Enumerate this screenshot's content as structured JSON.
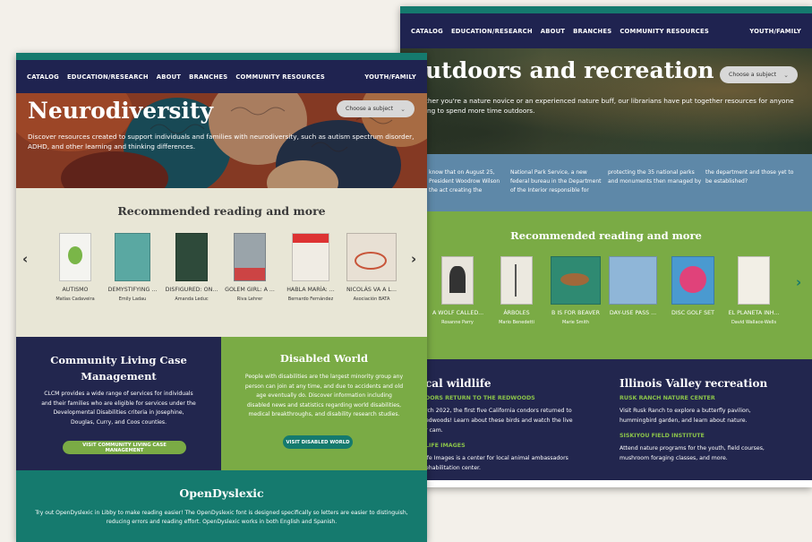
{
  "back": {
    "nav": {
      "items": [
        "CATALOG",
        "EDUCATION/RESEARCH",
        "ABOUT",
        "BRANCHES",
        "COMMUNITY RESOURCES"
      ],
      "right": "YOUTH/FAMILY"
    },
    "hero": {
      "title": "utdoors and recreation",
      "desc_l1": "ther you're a nature novice or an experienced nature buff, our librarians have put together resources for anyone",
      "desc_l2": "ing to spend more time outdoors.",
      "dropdown": "Choose a subject"
    },
    "facts": [
      {
        "l1": "know that on August 25,",
        "l2": "President Woodrow Wilson",
        "l3": "the act creating the"
      },
      {
        "l1": "National Park Service, a new",
        "l2": "federal bureau in the Department",
        "l3": "of the Interior responsible for"
      },
      {
        "l1": "protecting the 35 national parks",
        "l2": "and monuments then managed by",
        "l3": ""
      },
      {
        "l1": "the department and those yet to",
        "l2": "be established?",
        "l3": ""
      }
    ],
    "reading": {
      "heading": "Recommended reading and more",
      "books": [
        {
          "title": "A WOLF CALLED...",
          "author": "Rosanne Parry",
          "color": "#e8e4dc"
        },
        {
          "title": "ÁRBOLES",
          "author": "Mario Benedetti",
          "color": "#ece9e0"
        },
        {
          "title": "B IS FOR BEAVER",
          "author": "Marie Smith",
          "color": "#2f8a72"
        },
        {
          "title": "DAY-USE PASS ...",
          "author": "",
          "color": "#8fb6d8"
        },
        {
          "title": "DISC GOLF SET",
          "author": "",
          "color": "#4a9ad0"
        },
        {
          "title": "EL PLANETA INH...",
          "author": "David Wallace-Wells",
          "color": "#f2efe6"
        }
      ]
    },
    "wildlife": {
      "heading": "cal wildlife",
      "sub1": "DORS RETURN TO THE REDWOODS",
      "p1_l1": "rch 2022, the first five California condors returned to",
      "p1_l2": "edwoods! Learn about these birds and watch the live",
      "p1_l3": "r cam.",
      "sub2": "LIFE IMAGES",
      "p2_l1": "ife Images is a center for local animal ambassadors",
      "p2_l2": "ehabilitation center."
    },
    "illinois": {
      "heading": "Illinois Valley recreation",
      "sub1": "RUSK RANCH NATURE CENTER",
      "p1_l1": "Visit Rusk Ranch to explore a butterfly pavilion,",
      "p1_l2": "hummingbird garden, and learn about nature.",
      "sub2": "SISKIYOU FIELD INSTITUTE",
      "p2_l1": "Attend nature programs for the youth, field courses,",
      "p2_l2": "mushroom foraging classes, and more."
    }
  },
  "front": {
    "nav": {
      "items": [
        "CATALOG",
        "EDUCATION/RESEARCH",
        "ABOUT",
        "BRANCHES",
        "COMMUNITY RESOURCES"
      ],
      "right": "YOUTH/FAMILY"
    },
    "hero": {
      "title": "Neurodiversity",
      "desc_l1": "Discover resources created to support individuals and families with neurodiversity, such as autism spectrum disorder,",
      "desc_l2": "ADHD, and other learning and thinking differences.",
      "dropdown": "Choose a subject"
    },
    "reading": {
      "heading": "Recommended reading and more",
      "books": [
        {
          "title": "AUTISMO",
          "author": "Matías Cadaveira",
          "color": "#f4f4f0"
        },
        {
          "title": "DEMYSTIFYING ...",
          "author": "Emily Ladau",
          "color": "#5aa8a2"
        },
        {
          "title": "DISFIGURED: ON...",
          "author": "Amanda Leduc",
          "color": "#2e4a3a"
        },
        {
          "title": "GOLEM GIRL: A ...",
          "author": "Riva Lehrer",
          "color": "#9aa4aa"
        },
        {
          "title": "HABLA MARÍA: ...",
          "author": "Bernardo Fernández",
          "color": "#f0ece4"
        },
        {
          "title": "NICOLÁS VA A L...",
          "author": "Asociación BATA",
          "color": "#e8e0d4"
        }
      ]
    },
    "clcm": {
      "heading_l1": "Community Living Case",
      "heading_l2": "Management",
      "p_l1": "CLCM provides a wide range of services for individuals",
      "p_l2": "and their families who are eligible for services under the",
      "p_l3": "Developmental Disabilities criteria in Josephine,",
      "p_l4": "Douglas, Curry, and Coos counties.",
      "button": "VISIT COMMUNITY LIVING CASE MANAGEMENT"
    },
    "disabled": {
      "heading": "Disabled World",
      "p_l1": "People with disabilities are the largest minority group any",
      "p_l2": "person can join at any time, and due to accidents and old",
      "p_l3": "age eventually do. Discover information including",
      "p_l4": "disabled news and statistics regarding world disabilities,",
      "p_l5": "medical breakthroughs, and disability research studies.",
      "button": "VISIT DISABLED WORLD"
    },
    "dyslexic": {
      "heading": "OpenDyslexic",
      "p_l1": "Try out OpenDyslexic in Libby to make reading easier! The OpenDyslexic font is designed specifically so letters are easier to distinguish,",
      "p_l2": "reducing errors and reading effort. OpenDyslexic works in both English and Spanish."
    }
  },
  "colors": {
    "navy": "#1f2350",
    "teal": "#157a6e",
    "green": "#7aab45",
    "blue_band": "#5e88a8",
    "cream": "#e8e6d6"
  }
}
